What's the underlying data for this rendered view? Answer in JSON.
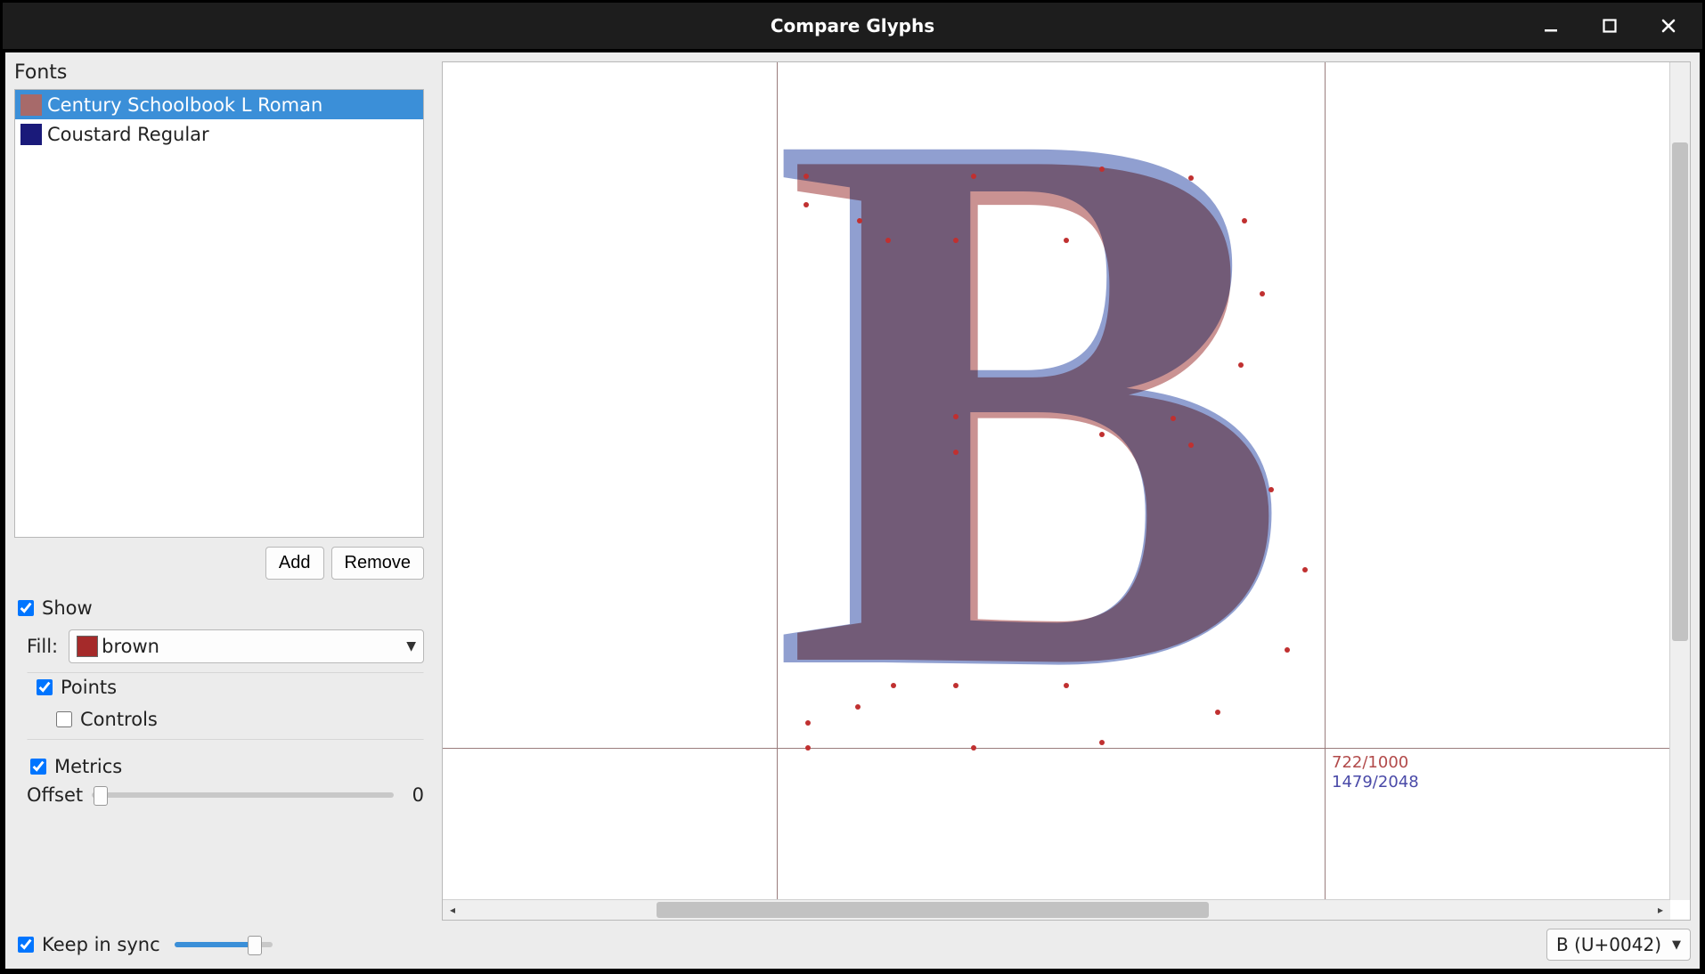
{
  "window": {
    "title": "Compare Glyphs"
  },
  "sidebar": {
    "fonts_label": "Fonts",
    "fonts": [
      {
        "name": "Century Schoolbook L Roman",
        "swatch": "#a76a6a",
        "selected": true
      },
      {
        "name": "Coustard Regular",
        "swatch": "#1a1a7a",
        "selected": false
      }
    ],
    "add_label": "Add",
    "remove_label": "Remove",
    "show_label": "Show",
    "show_checked": true,
    "fill_label": "Fill:",
    "fill_value": "brown",
    "fill_swatch": "#a52a2a",
    "points_label": "Points",
    "points_checked": true,
    "controls_label": "Controls",
    "controls_checked": false,
    "metrics_label": "Metrics",
    "metrics_checked": true,
    "offset_label": "Offset",
    "offset_value": "0"
  },
  "canvas": {
    "glyph": "B",
    "metric_top": "722/1000",
    "metric_top_color": "#b24a4a",
    "metric_bottom": "1479/2048",
    "metric_bottom_color": "#4a4aa8"
  },
  "bottom": {
    "keep_in_sync_label": "Keep in sync",
    "keep_in_sync_checked": true,
    "glyph_select": "B  (U+0042)"
  }
}
